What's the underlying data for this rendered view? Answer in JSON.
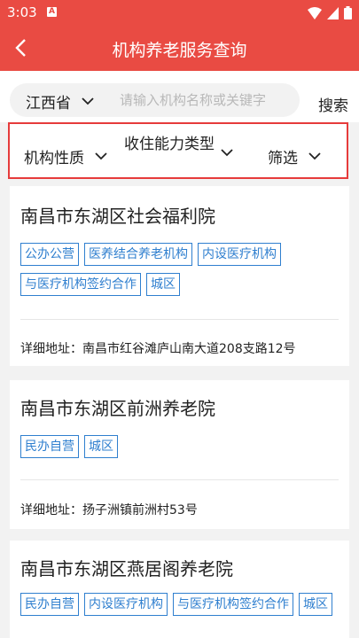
{
  "status": {
    "time": "3:03",
    "notif": "A"
  },
  "header": {
    "title": "机构养老服务查询"
  },
  "search": {
    "province": "江西省",
    "placeholder": "请输入机构名称或关键字",
    "button": "搜索"
  },
  "filters": {
    "nature": "机构性质",
    "capacity": "收住能力类型",
    "filter": "筛选"
  },
  "labels": {
    "address_prefix": "详细地址："
  },
  "institutions": [
    {
      "name": "南昌市东湖区社会福利院",
      "tags": [
        "公办公营",
        "医养结合养老机构",
        "内设医疗机构",
        "与医疗机构签约合作",
        "城区"
      ],
      "address": "南昌市红谷滩庐山南大道208支路12号"
    },
    {
      "name": "南昌市东湖区前洲养老院",
      "tags": [
        "民办自营",
        "城区"
      ],
      "address": "扬子洲镇前洲村53号"
    },
    {
      "name": "南昌市东湖区燕居阁养老院",
      "tags": [
        "民办自营",
        "内设医疗机构",
        "与医疗机构签约合作",
        "城区"
      ],
      "address": ""
    }
  ],
  "colors": {
    "header_bg": "#e94b43",
    "tag": "#2f7fcf",
    "highlight_border": "#e63b3b"
  }
}
